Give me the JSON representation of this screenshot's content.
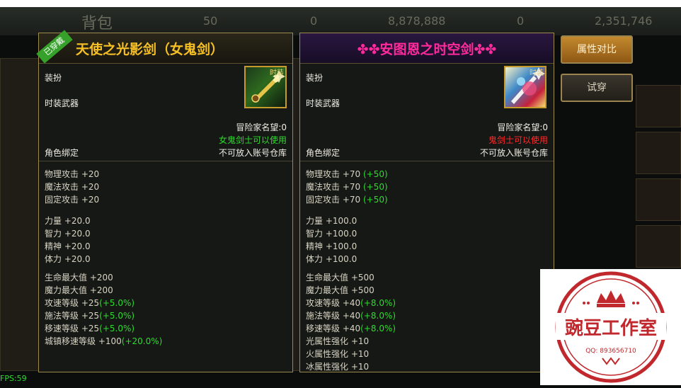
{
  "background": {
    "title": "背包",
    "currency_values": [
      "50",
      "0",
      "8,878,888",
      "0",
      "2,351,746"
    ]
  },
  "left_item": {
    "equipped_badge": "已穿戴",
    "name": "天使之光影剑（女鬼剑）",
    "category": "装扮",
    "sub_category": "时装武器",
    "icon_badge": "时装",
    "fame": "冒险家名望:0",
    "usable": "女鬼剑士可以使用",
    "binding": "角色绑定",
    "storage": "不可放入账号仓库",
    "stats_attack": [
      {
        "label": "物理攻击 +20",
        "bonus": ""
      },
      {
        "label": "魔法攻击 +20",
        "bonus": ""
      },
      {
        "label": "固定攻击 +20",
        "bonus": ""
      }
    ],
    "stats_attr": [
      {
        "label": "力量 +20.0",
        "bonus": ""
      },
      {
        "label": "智力 +20.0",
        "bonus": ""
      },
      {
        "label": "精神 +20.0",
        "bonus": ""
      },
      {
        "label": "体力 +20.0",
        "bonus": ""
      }
    ],
    "stats_misc": [
      {
        "label": "生命最大值 +200",
        "bonus": ""
      },
      {
        "label": "魔力最大值 +200",
        "bonus": ""
      },
      {
        "label": "攻速等级 +25",
        "bonus": "(+5.0%)"
      },
      {
        "label": "施法等级 +25",
        "bonus": "(+5.0%)"
      },
      {
        "label": "移速等级 +25",
        "bonus": "(+5.0%)"
      },
      {
        "label": "城镇移速等级 +100",
        "bonus": "(+20.0%)"
      }
    ]
  },
  "right_item": {
    "name": "✤✤安图恩之时空剑✤✤",
    "category": "装扮",
    "sub_category": "时装武器",
    "icon_badge": "时装",
    "fame": "冒险家名望:0",
    "usable": "鬼剑士可以使用",
    "binding": "角色绑定",
    "storage": "不可放入账号仓库",
    "stats_attack": [
      {
        "label": "物理攻击 +70 ",
        "bonus": "(+50)"
      },
      {
        "label": "魔法攻击 +70 ",
        "bonus": "(+50)"
      },
      {
        "label": "固定攻击 +70 ",
        "bonus": "(+50)"
      }
    ],
    "stats_attr": [
      {
        "label": "力量 +100.0",
        "bonus": ""
      },
      {
        "label": "智力 +100.0",
        "bonus": ""
      },
      {
        "label": "精神 +100.0",
        "bonus": ""
      },
      {
        "label": "体力 +100.0",
        "bonus": ""
      }
    ],
    "stats_misc": [
      {
        "label": "生命最大值 +500",
        "bonus": ""
      },
      {
        "label": "魔力最大值 +500",
        "bonus": ""
      },
      {
        "label": "攻速等级 +40",
        "bonus": "(+8.0%)"
      },
      {
        "label": "施法等级 +40",
        "bonus": "(+8.0%)"
      },
      {
        "label": "移速等级 +40",
        "bonus": "(+8.0%)"
      },
      {
        "label": "光属性强化 +10",
        "bonus": ""
      },
      {
        "label": "火属性强化 +10",
        "bonus": ""
      },
      {
        "label": "冰属性强化 +10",
        "bonus": ""
      }
    ]
  },
  "buttons": {
    "compare": "属性对比",
    "try_on": "试穿"
  },
  "fps": "FPS:59",
  "watermark": {
    "name": "豌豆工作室",
    "qq": "QQ: 893656710"
  },
  "colors": {
    "green_bonus": "#2ddc2d",
    "gold_title": "#f6c024",
    "pink_title": "#ff2a9c",
    "red_warning": "#ff2a2a"
  }
}
